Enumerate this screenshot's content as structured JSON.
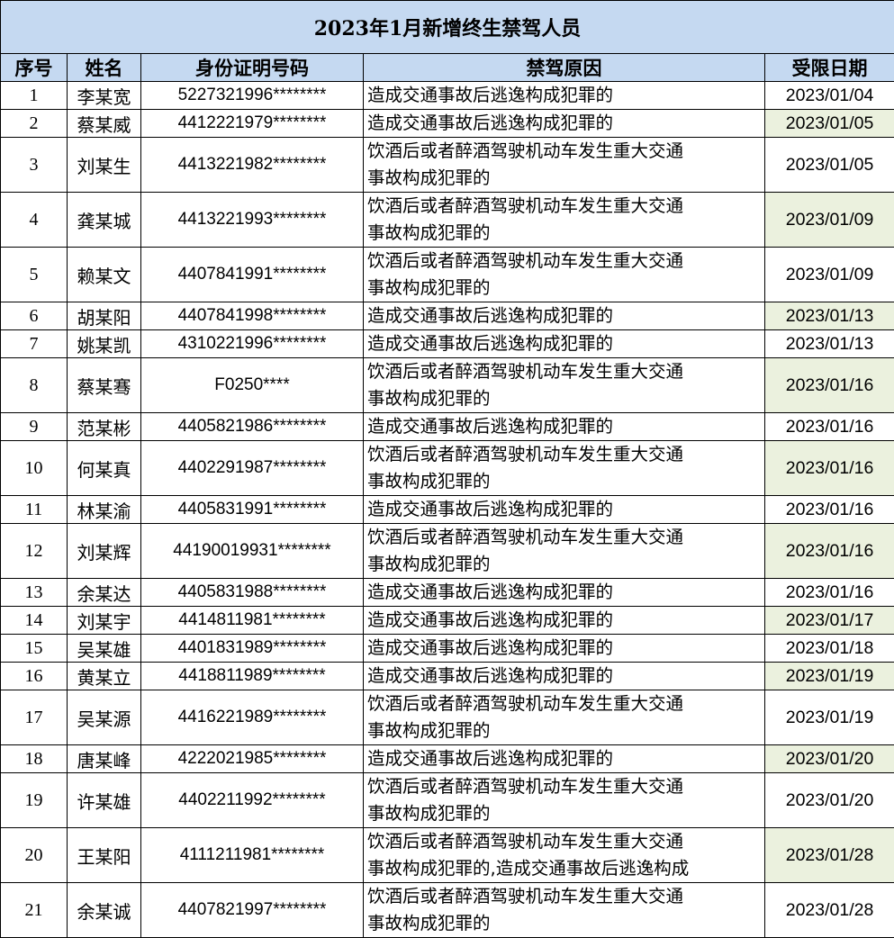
{
  "title": "2023年1月新增终生禁驾人员",
  "headers": {
    "no": "序号",
    "name": "姓名",
    "id": "身份证明号码",
    "reason": "禁驾原因",
    "date": "受限日期"
  },
  "highlight_color": "#ebf1de",
  "header_color": "#c5d9f1",
  "rows": [
    {
      "no": "1",
      "name": "李某宽",
      "id": "5227321996********",
      "reason": "造成交通事故后逃逸构成犯罪的",
      "date": "2023/01/04",
      "hl": false,
      "lines": 1
    },
    {
      "no": "2",
      "name": "蔡某威",
      "id": "4412221979********",
      "reason": "造成交通事故后逃逸构成犯罪的",
      "date": "2023/01/05",
      "hl": true,
      "lines": 1
    },
    {
      "no": "3",
      "name": "刘某生",
      "id": "4413221982********",
      "reason": "饮酒后或者醉酒驾驶机动车发生重大交通\n事故构成犯罪的",
      "date": "2023/01/05",
      "hl": false,
      "lines": 2
    },
    {
      "no": "4",
      "name": "龚某城",
      "id": "4413221993********",
      "reason": "饮酒后或者醉酒驾驶机动车发生重大交通\n事故构成犯罪的",
      "date": "2023/01/09",
      "hl": true,
      "lines": 2
    },
    {
      "no": "5",
      "name": "赖某文",
      "id": "4407841991********",
      "reason": "饮酒后或者醉酒驾驶机动车发生重大交通\n事故构成犯罪的",
      "date": "2023/01/09",
      "hl": false,
      "lines": 2
    },
    {
      "no": "6",
      "name": "胡某阳",
      "id": "4407841998********",
      "reason": "造成交通事故后逃逸构成犯罪的",
      "date": "2023/01/13",
      "hl": true,
      "lines": 1
    },
    {
      "no": "7",
      "name": "姚某凯",
      "id": "4310221996********",
      "reason": "造成交通事故后逃逸构成犯罪的",
      "date": "2023/01/13",
      "hl": false,
      "lines": 1
    },
    {
      "no": "8",
      "name": "蔡某骞",
      "id": "F0250****",
      "reason": "饮酒后或者醉酒驾驶机动车发生重大交通\n事故构成犯罪的",
      "date": "2023/01/16",
      "hl": true,
      "lines": 2
    },
    {
      "no": "9",
      "name": "范某彬",
      "id": "4405821986********",
      "reason": "造成交通事故后逃逸构成犯罪的",
      "date": "2023/01/16",
      "hl": false,
      "lines": 1
    },
    {
      "no": "10",
      "name": "何某真",
      "id": "4402291987********",
      "reason": "饮酒后或者醉酒驾驶机动车发生重大交通\n事故构成犯罪的",
      "date": "2023/01/16",
      "hl": true,
      "lines": 2
    },
    {
      "no": "11",
      "name": "林某渝",
      "id": "4405831991********",
      "reason": "造成交通事故后逃逸构成犯罪的",
      "date": "2023/01/16",
      "hl": false,
      "lines": 1
    },
    {
      "no": "12",
      "name": "刘某辉",
      "id": "44190019931********",
      "reason": "饮酒后或者醉酒驾驶机动车发生重大交通\n事故构成犯罪的",
      "date": "2023/01/16",
      "hl": true,
      "lines": 2
    },
    {
      "no": "13",
      "name": "余某达",
      "id": "4405831988********",
      "reason": "造成交通事故后逃逸构成犯罪的",
      "date": "2023/01/16",
      "hl": false,
      "lines": 1
    },
    {
      "no": "14",
      "name": "刘某宇",
      "id": "4414811981********",
      "reason": "造成交通事故后逃逸构成犯罪的",
      "date": "2023/01/17",
      "hl": true,
      "lines": 1
    },
    {
      "no": "15",
      "name": "吴某雄",
      "id": "4401831989********",
      "reason": "造成交通事故后逃逸构成犯罪的",
      "date": "2023/01/18",
      "hl": false,
      "lines": 1
    },
    {
      "no": "16",
      "name": "黄某立",
      "id": "4418811989********",
      "reason": "造成交通事故后逃逸构成犯罪的",
      "date": "2023/01/19",
      "hl": true,
      "lines": 1
    },
    {
      "no": "17",
      "name": "吴某源",
      "id": "4416221989********",
      "reason": "饮酒后或者醉酒驾驶机动车发生重大交通\n事故构成犯罪的",
      "date": "2023/01/19",
      "hl": false,
      "lines": 2
    },
    {
      "no": "18",
      "name": "唐某峰",
      "id": "4222021985********",
      "reason": "造成交通事故后逃逸构成犯罪的",
      "date": "2023/01/20",
      "hl": true,
      "lines": 1
    },
    {
      "no": "19",
      "name": "许某雄",
      "id": "4402211992********",
      "reason": "饮酒后或者醉酒驾驶机动车发生重大交通\n事故构成犯罪的",
      "date": "2023/01/20",
      "hl": false,
      "lines": 2
    },
    {
      "no": "20",
      "name": "王某阳",
      "id": "4111211981********",
      "reason": "饮酒后或者醉酒驾驶机动车发生重大交通\n事故构成犯罪的,造成交通事故后逃逸构成",
      "date": "2023/01/28",
      "hl": true,
      "lines": 2
    },
    {
      "no": "21",
      "name": "余某诚",
      "id": "4407821997********",
      "reason": "饮酒后或者醉酒驾驶机动车发生重大交通\n事故构成犯罪的",
      "date": "2023/01/28",
      "hl": false,
      "lines": 2
    }
  ]
}
